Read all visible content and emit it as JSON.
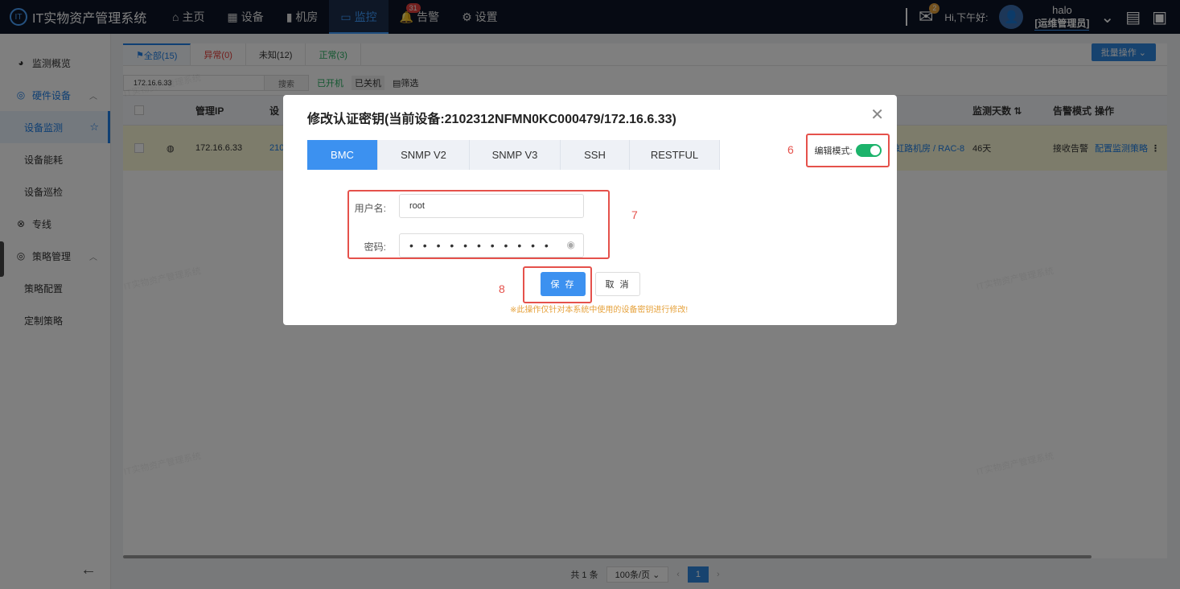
{
  "app": {
    "title": "IT实物资产管理系统"
  },
  "nav": {
    "items": [
      {
        "label": "主页",
        "icon": "home-icon"
      },
      {
        "label": "设备",
        "icon": "grid-icon"
      },
      {
        "label": "机房",
        "icon": "bar-chart-icon"
      },
      {
        "label": "监控",
        "icon": "monitor-icon",
        "active": true
      },
      {
        "label": "告警",
        "icon": "bell-icon",
        "badge": "31"
      },
      {
        "label": "设置",
        "icon": "gear-icon"
      }
    ]
  },
  "user": {
    "mail_badge": "2",
    "greeting": "Hi,下午好:",
    "name": "halo",
    "role": "[运维管理员]"
  },
  "sidebar": {
    "items": [
      {
        "label": "监测概览",
        "icon": "pie-icon"
      },
      {
        "label": "硬件设备",
        "icon": "bulb-icon"
      },
      {
        "label": "设备监测"
      },
      {
        "label": "设备能耗"
      },
      {
        "label": "设备巡检"
      },
      {
        "label": "专线",
        "icon": "link-icon"
      },
      {
        "label": "策略管理",
        "icon": "bulb-icon"
      },
      {
        "label": "策略配置"
      },
      {
        "label": "定制策略"
      }
    ]
  },
  "main": {
    "tabs": [
      "全部(15)",
      "异常(0)",
      "未知(12)",
      "正常(3)"
    ],
    "batch_label": "批量操作",
    "search": {
      "value": "172.16.6.33",
      "button": "搜索"
    },
    "chips": {
      "on": "已开机",
      "off": "已关机",
      "filter": "筛选"
    },
    "columns": {
      "ip": "管理IP",
      "dev": "设",
      "days": "监测天数",
      "alarm": "告警模式",
      "op": "操作"
    },
    "row": {
      "ip": "172.16.6.33",
      "dev": "210",
      "location": "虹路机房 / RAC-8",
      "days": "46天",
      "alarm": "接收告警",
      "op": "配置监测策略"
    },
    "pager": {
      "total": "共 1 条",
      "size": "100条/页",
      "page": "1"
    },
    "watermark": "IT实物资产管理系统"
  },
  "modal": {
    "title": "修改认证密钥(当前设备:2102312NFMN0KC000479/172.16.6.33)",
    "tabs": [
      "BMC",
      "SNMP V2",
      "SNMP V3",
      "SSH",
      "RESTFUL"
    ],
    "edit_mode_label": "编辑模式:",
    "username_label": "用户名:",
    "username_value": "root",
    "password_label": "密码:",
    "password_value": "• • • • • • • • • • •",
    "save": "保 存",
    "cancel": "取 消",
    "note": "※此操作仅针对本系统中使用的设备密钥进行修改!",
    "callouts": [
      "6",
      "7",
      "8"
    ]
  }
}
